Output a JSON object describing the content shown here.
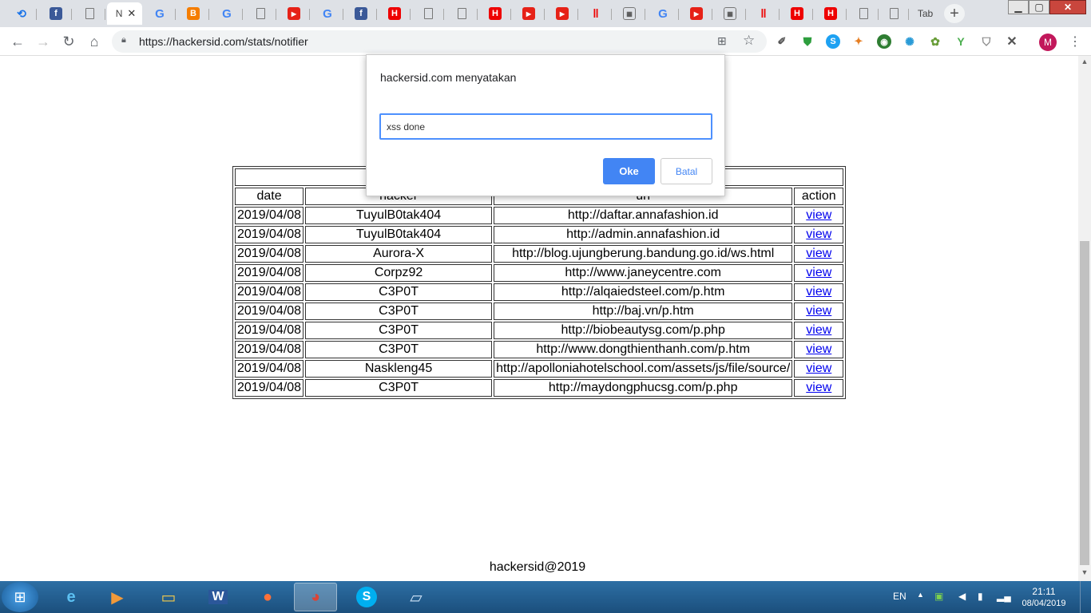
{
  "browser": {
    "active_tab_label": "N",
    "last_tab_label": "Tab",
    "url": "https://hackersid.com/stats/notifier",
    "profile_initial": "M"
  },
  "dialog": {
    "title": "hackersid.com menyatakan",
    "input_value": "xss done",
    "ok_label": "Oke",
    "cancel_label": "Batal"
  },
  "table": {
    "headers": {
      "date": "date",
      "hacker": "hacker",
      "url": "url",
      "action": "action"
    },
    "rows": [
      {
        "date": "2019/04/08",
        "hacker": "TuyulB0tak404",
        "url": "http://daftar.annafashion.id",
        "action": "view"
      },
      {
        "date": "2019/04/08",
        "hacker": "TuyulB0tak404",
        "url": "http://admin.annafashion.id",
        "action": "view"
      },
      {
        "date": "2019/04/08",
        "hacker": "Aurora-X",
        "url": "http://blog.ujungberung.bandung.go.id/ws.html",
        "action": "view"
      },
      {
        "date": "2019/04/08",
        "hacker": "Corpz92",
        "url": "http://www.janeycentre.com",
        "action": "view"
      },
      {
        "date": "2019/04/08",
        "hacker": "C3P0T",
        "url": "http://alqaiedsteel.com/p.htm",
        "action": "view"
      },
      {
        "date": "2019/04/08",
        "hacker": "C3P0T",
        "url": "http://baj.vn/p.htm",
        "action": "view"
      },
      {
        "date": "2019/04/08",
        "hacker": "C3P0T",
        "url": "http://biobeautysg.com/p.php",
        "action": "view"
      },
      {
        "date": "2019/04/08",
        "hacker": "C3P0T",
        "url": "http://www.dongthienthanh.com/p.htm",
        "action": "view"
      },
      {
        "date": "2019/04/08",
        "hacker": "Naskleng45",
        "url": "http://apolloniahotelschool.com/assets/js/file/source/",
        "action": "view"
      },
      {
        "date": "2019/04/08",
        "hacker": "C3P0T",
        "url": "http://maydongphucsg.com/p.php",
        "action": "view"
      }
    ]
  },
  "footer": {
    "text": "hackersid@2019"
  },
  "taskbar": {
    "language": "EN",
    "time": "21:11",
    "date": "08/04/2019"
  }
}
